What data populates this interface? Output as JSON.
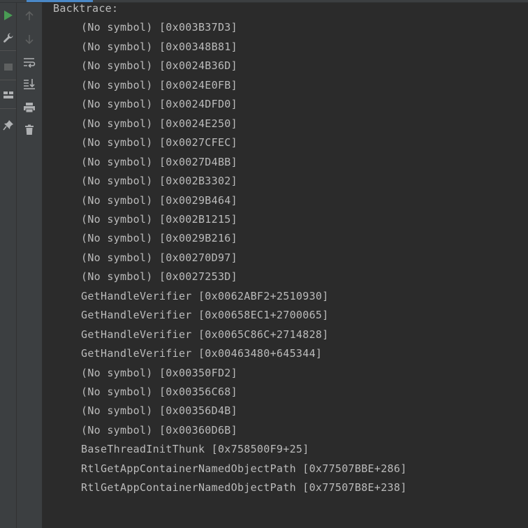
{
  "colors": {
    "background": "#2b2b2b",
    "toolbar": "#3c3f41",
    "text": "#bbbbbb",
    "run_green": "#499c54",
    "icon_gray": "#afb1b3",
    "icon_disabled": "#5e6060",
    "accent_blue": "#4a88c7"
  },
  "left_toolbar": {
    "items": [
      {
        "name": "run-icon",
        "interactable": true
      },
      {
        "name": "wrench-icon",
        "interactable": true
      },
      {
        "name": "stop-icon",
        "interactable": true
      },
      {
        "name": "layout-icon",
        "interactable": true
      },
      {
        "name": "pin-icon",
        "interactable": true
      }
    ]
  },
  "console_toolbar": {
    "items": [
      {
        "name": "arrow-up-icon",
        "interactable": true,
        "disabled": true
      },
      {
        "name": "arrow-down-icon",
        "interactable": true,
        "disabled": true
      },
      {
        "name": "soft-wrap-icon",
        "interactable": true
      },
      {
        "name": "scroll-to-end-icon",
        "interactable": true
      },
      {
        "name": "print-icon",
        "interactable": true
      },
      {
        "name": "trash-icon",
        "interactable": true
      }
    ]
  },
  "console": {
    "header": "Backtrace:",
    "lines": [
      "(No symbol) [0x003B37D3]",
      "(No symbol) [0x00348B81]",
      "(No symbol) [0x0024B36D]",
      "(No symbol) [0x0024E0FB]",
      "(No symbol) [0x0024DFD0]",
      "(No symbol) [0x0024E250]",
      "(No symbol) [0x0027CFEC]",
      "(No symbol) [0x0027D4BB]",
      "(No symbol) [0x002B3302]",
      "(No symbol) [0x0029B464]",
      "(No symbol) [0x002B1215]",
      "(No symbol) [0x0029B216]",
      "(No symbol) [0x00270D97]",
      "(No symbol) [0x0027253D]",
      "GetHandleVerifier [0x0062ABF2+2510930]",
      "GetHandleVerifier [0x00658EC1+2700065]",
      "GetHandleVerifier [0x0065C86C+2714828]",
      "GetHandleVerifier [0x00463480+645344]",
      "(No symbol) [0x00350FD2]",
      "(No symbol) [0x00356C68]",
      "(No symbol) [0x00356D4B]",
      "(No symbol) [0x00360D6B]",
      "BaseThreadInitThunk [0x758500F9+25]",
      "RtlGetAppContainerNamedObjectPath [0x77507BBE+286]",
      "RtlGetAppContainerNamedObjectPath [0x77507B8E+238]"
    ]
  }
}
